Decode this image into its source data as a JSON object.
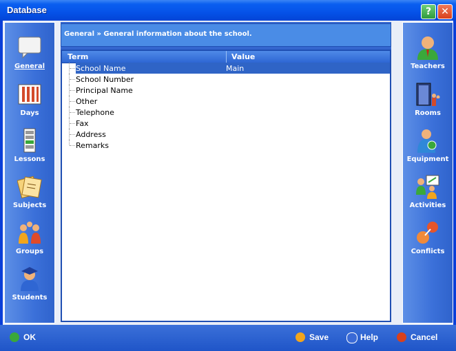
{
  "window": {
    "title": "Database",
    "help_btn": "?",
    "close_btn": "✕"
  },
  "left_nav": [
    {
      "label": "General",
      "icon": "speech-bubble-icon",
      "active": true
    },
    {
      "label": "Days",
      "icon": "calendar-bars-icon",
      "active": false
    },
    {
      "label": "Lessons",
      "icon": "lesson-bars-icon",
      "active": false
    },
    {
      "label": "Subjects",
      "icon": "notes-icon",
      "active": false
    },
    {
      "label": "Groups",
      "icon": "group-people-icon",
      "active": false
    },
    {
      "label": "Students",
      "icon": "student-icon",
      "active": false
    }
  ],
  "right_nav": [
    {
      "label": "Teachers",
      "icon": "teacher-icon"
    },
    {
      "label": "Rooms",
      "icon": "room-door-icon"
    },
    {
      "label": "Equipment",
      "icon": "equipment-icon"
    },
    {
      "label": "Activities",
      "icon": "activities-icon"
    },
    {
      "label": "Conflicts",
      "icon": "conflicts-icon"
    }
  ],
  "breadcrumb": "General » General information about the school.",
  "table": {
    "columns": [
      "Term",
      "Value"
    ],
    "rows": [
      {
        "term": "School Name",
        "value": "Main",
        "selected": true
      },
      {
        "term": "School Number",
        "value": ""
      },
      {
        "term": "Principal Name",
        "value": ""
      },
      {
        "term": "Other",
        "value": ""
      },
      {
        "term": "Telephone",
        "value": ""
      },
      {
        "term": "Fax",
        "value": ""
      },
      {
        "term": "Address",
        "value": ""
      },
      {
        "term": "Remarks",
        "value": ""
      }
    ]
  },
  "buttons": {
    "ok": "OK",
    "save": "Save",
    "help": "Help",
    "cancel": "Cancel"
  },
  "colors": {
    "title_blue": "#0552e8",
    "sidebar_blue": "#3b70d9",
    "selection": "#2f64c6"
  }
}
